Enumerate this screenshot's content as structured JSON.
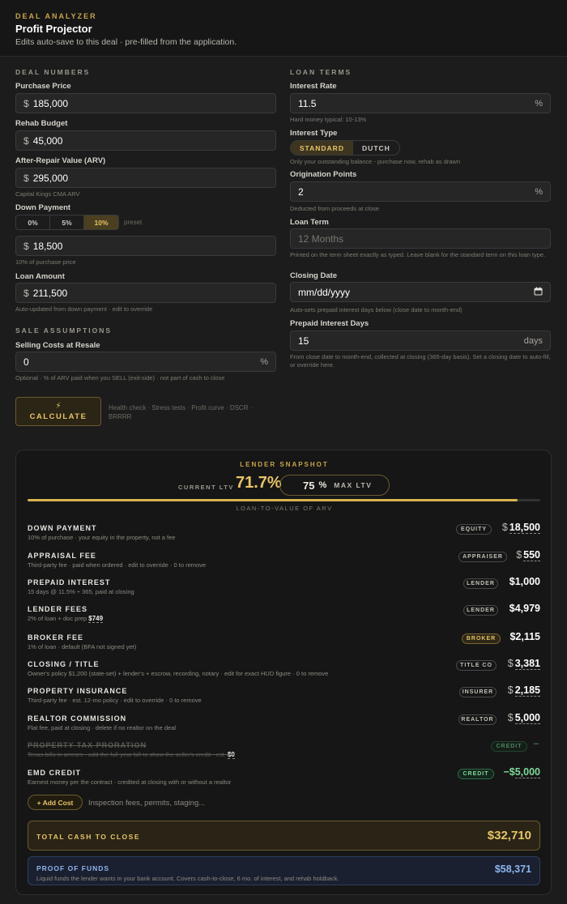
{
  "header": {
    "eyebrow": "DEAL ANALYZER",
    "title": "Profit Projector",
    "subtitle": "Edits auto-save to this deal · pre-filled from the application."
  },
  "deal_numbers": {
    "section": "DEAL NUMBERS",
    "purchase_price": {
      "label": "Purchase Price",
      "currency": "$",
      "value": "185,000"
    },
    "rehab_budget": {
      "label": "Rehab Budget",
      "currency": "$",
      "value": "45,000"
    },
    "arv": {
      "label": "After-Repair Value (ARV)",
      "currency": "$",
      "value": "295,000",
      "hint": "Capital Kings CMA ARV"
    },
    "down_payment": {
      "label": "Down Payment",
      "options": [
        "0%",
        "5%",
        "10%"
      ],
      "selected": "10%",
      "preset_label": "preset",
      "currency": "$",
      "value": "18,500",
      "hint": "10% of purchase price"
    },
    "loan_amount": {
      "label": "Loan Amount",
      "currency": "$",
      "value": "211,500",
      "hint": "Auto-updated from down payment · edit to override"
    }
  },
  "sale_assumptions": {
    "section": "SALE ASSUMPTIONS",
    "selling_costs": {
      "label": "Selling Costs at Resale",
      "value": "0",
      "suffix": "%",
      "hint": "Optional · % of ARV paid when you SELL (exit-side) · not part of cash to close"
    }
  },
  "loan_terms": {
    "section": "LOAN TERMS",
    "interest_rate": {
      "label": "Interest Rate",
      "value": "11.5",
      "suffix": "%",
      "hint": "Hard money typical: 10-13%"
    },
    "interest_type": {
      "label": "Interest Type",
      "options": [
        "STANDARD",
        "DUTCH"
      ],
      "selected": "STANDARD",
      "hint": "Only your outstanding balance - purchase now, rehab as drawn"
    },
    "origination_points": {
      "label": "Origination Points",
      "value": "2",
      "suffix": "%",
      "hint": "Deducted from proceeds at close"
    },
    "loan_term": {
      "label": "Loan Term",
      "placeholder": "12 Months",
      "hint": "Printed on the term sheet exactly as typed. Leave blank for the standard term on this loan type."
    },
    "closing_date": {
      "label": "Closing Date",
      "placeholder": "mm/dd/yyyy",
      "hint": "Auto-sets prepaid interest days below (close date to month-end)"
    },
    "prepaid_interest_days": {
      "label": "Prepaid Interest Days",
      "value": "15",
      "suffix": "days",
      "hint": "From close date to month-end, collected at closing (365-day basis). Set a closing date to auto-fill, or override here."
    }
  },
  "calculate": {
    "icon": "lightning-icon",
    "label": "CALCULATE",
    "hint": "Health check · Stress tests · Profit curve · DSCR · BRRRR"
  },
  "snapshot": {
    "title": "LENDER SNAPSHOT",
    "current_ltv_label": "CURRENT LTV",
    "current_ltv": "71.7%",
    "current_ltv_value": 71.7,
    "max_ltv_value": "75",
    "max_ltv_pct": "%",
    "max_ltv_label": "MAX LTV",
    "bar_caption": "LOAN-TO-VALUE OF ARV",
    "bar_fill_fraction": 0.956
  },
  "costs": [
    {
      "name": "DOWN PAYMENT",
      "desc": "10% of purchase · your equity in the property, not a fee",
      "tag": "EQUITY",
      "dollar": "$",
      "amount": "18,500"
    },
    {
      "name": "APPRAISAL FEE",
      "desc": "Third-party fee · paid when ordered · edit to override · 0 to remove",
      "tag": "APPRAISER",
      "dollar": "$",
      "amount": "550"
    },
    {
      "name": "PREPAID INTEREST",
      "desc": "15 days @ 11.5% ÷ 365, paid at closing",
      "tag": "LENDER",
      "amount": "$1,000"
    },
    {
      "name": "LENDER FEES",
      "desc": "2% of loan + doc prep ",
      "desc_value": "$749",
      "tag": "LENDER",
      "amount": "$4,979"
    },
    {
      "name": "BROKER FEE",
      "desc": "1% of loan · default (BFA not signed yet)",
      "tag": "BROKER",
      "amount": "$2,115"
    },
    {
      "name": "CLOSING / TITLE",
      "desc": "Owner's policy $1,200 (state-set) + lender's + escrow, recording, notary · edit for exact HUD figure · 0 to remove",
      "tag": "TITLE CO",
      "dollar": "$",
      "amount": "3,381"
    },
    {
      "name": "PROPERTY INSURANCE",
      "desc": "Third-party fee · est. 12-mo policy · edit to override · 0 to remove",
      "tag": "INSURER",
      "dollar": "$",
      "amount": "2,185"
    },
    {
      "name": "REALTOR COMMISSION",
      "desc": "Flat fee, paid at closing · delete if no realtor on the deal",
      "tag": "REALTOR",
      "dollar": "$",
      "amount": "5,000"
    },
    {
      "name": "PROPERTY TAX PRORATION",
      "desc": "Texas bills in arrears · add the full-year bill to show the seller's credit · est. ",
      "desc_value": "$0",
      "tag": "CREDIT",
      "amount": "–"
    },
    {
      "name": "EMD CREDIT",
      "desc": "Earnest money per the contract · credited at closing with or without a realtor",
      "tag": "CREDIT",
      "amount_prefix": "−$",
      "amount": "5,000"
    }
  ],
  "add_cost": {
    "label": "+ Add Cost",
    "hint": "Inspection fees, permits, staging..."
  },
  "total_cash": {
    "label": "TOTAL CASH TO CLOSE",
    "value": "$32,710"
  },
  "proof_of_funds": {
    "label": "PROOF OF FUNDS",
    "desc": "Liquid funds the lender wants in your bank account. Covers cash-to-close, 6 mo. of interest, and rehab holdback.",
    "value": "$58,371"
  },
  "colors": {
    "accent": "#e8c468",
    "credit": "#7fd99c",
    "proof": "#8fb4ee",
    "background": "#1c1c1c"
  }
}
